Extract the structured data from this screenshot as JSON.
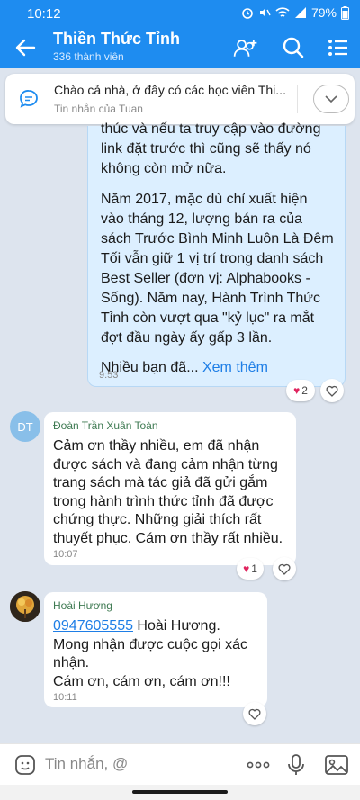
{
  "status_bar": {
    "time": "10:12",
    "battery": "79%"
  },
  "header": {
    "title": "Thiền Thức Tỉnh",
    "subtitle": "336 thành viên"
  },
  "pinned": {
    "title": "Chào cả nhà, ở đây có các học viên Thi...",
    "subtitle": "Tin nhắn của Tuan"
  },
  "messages": {
    "self": {
      "line1": "thúc và nếu ta truy cập vào đường",
      "line2": "link đặt trước thì cũng sẽ thấy nó",
      "line3": "không còn mở nữa.",
      "line4": "Năm 2017, mặc dù chỉ xuất hiện",
      "line5": "vào tháng 12, lượng bán ra của",
      "line6": "sách Trước Bình Minh Luôn Là Đêm",
      "line7": "Tối vẫn giữ 1 vị trí trong danh sách",
      "line8": "Best Seller (đơn vị: Alphabooks -",
      "line9": "Sống). Năm nay, Hành Trình Thức",
      "line10": "Tỉnh còn vượt qua \"kỷ lục\" ra mắt",
      "line11": "đợt đầu ngày ấy gấp 3 lần.",
      "line12": "Nhiều bạn đã...",
      "see_more": "Xem thêm",
      "time": "9:53",
      "reaction_count": "2"
    },
    "toan": {
      "avatar_initials": "DT",
      "sender": "Đoàn Trần Xuân Toàn",
      "line1": "Cảm ơn thầy nhiều, em đã nhận",
      "line2": "được sách và đang cảm nhận từng",
      "line3": "trang sách mà tác giả đã gửi gắm",
      "line4": "trong hành trình thức tỉnh đã được",
      "line5": "chứng thực. Những giải thích rất",
      "line6": "thuyết phục. Cám ơn thầy rất nhiều.",
      "time": "10:07",
      "reaction_count": "1"
    },
    "huong": {
      "sender": "Hoài Hương",
      "phone": "0947605555",
      "line1_rest": " Hoài Hương.",
      "line2": "Mong nhận được cuộc gọi xác",
      "line3": "nhận.",
      "line4": "Cám ơn, cám ơn, cám ơn!!!",
      "time": "10:11"
    }
  },
  "composer": {
    "placeholder": "Tin nhắn, @"
  },
  "colors": {
    "header": "#1e8cf0",
    "self_bubble": "#dcefff",
    "link": "#1e7ee6",
    "heart": "#e0245e"
  }
}
